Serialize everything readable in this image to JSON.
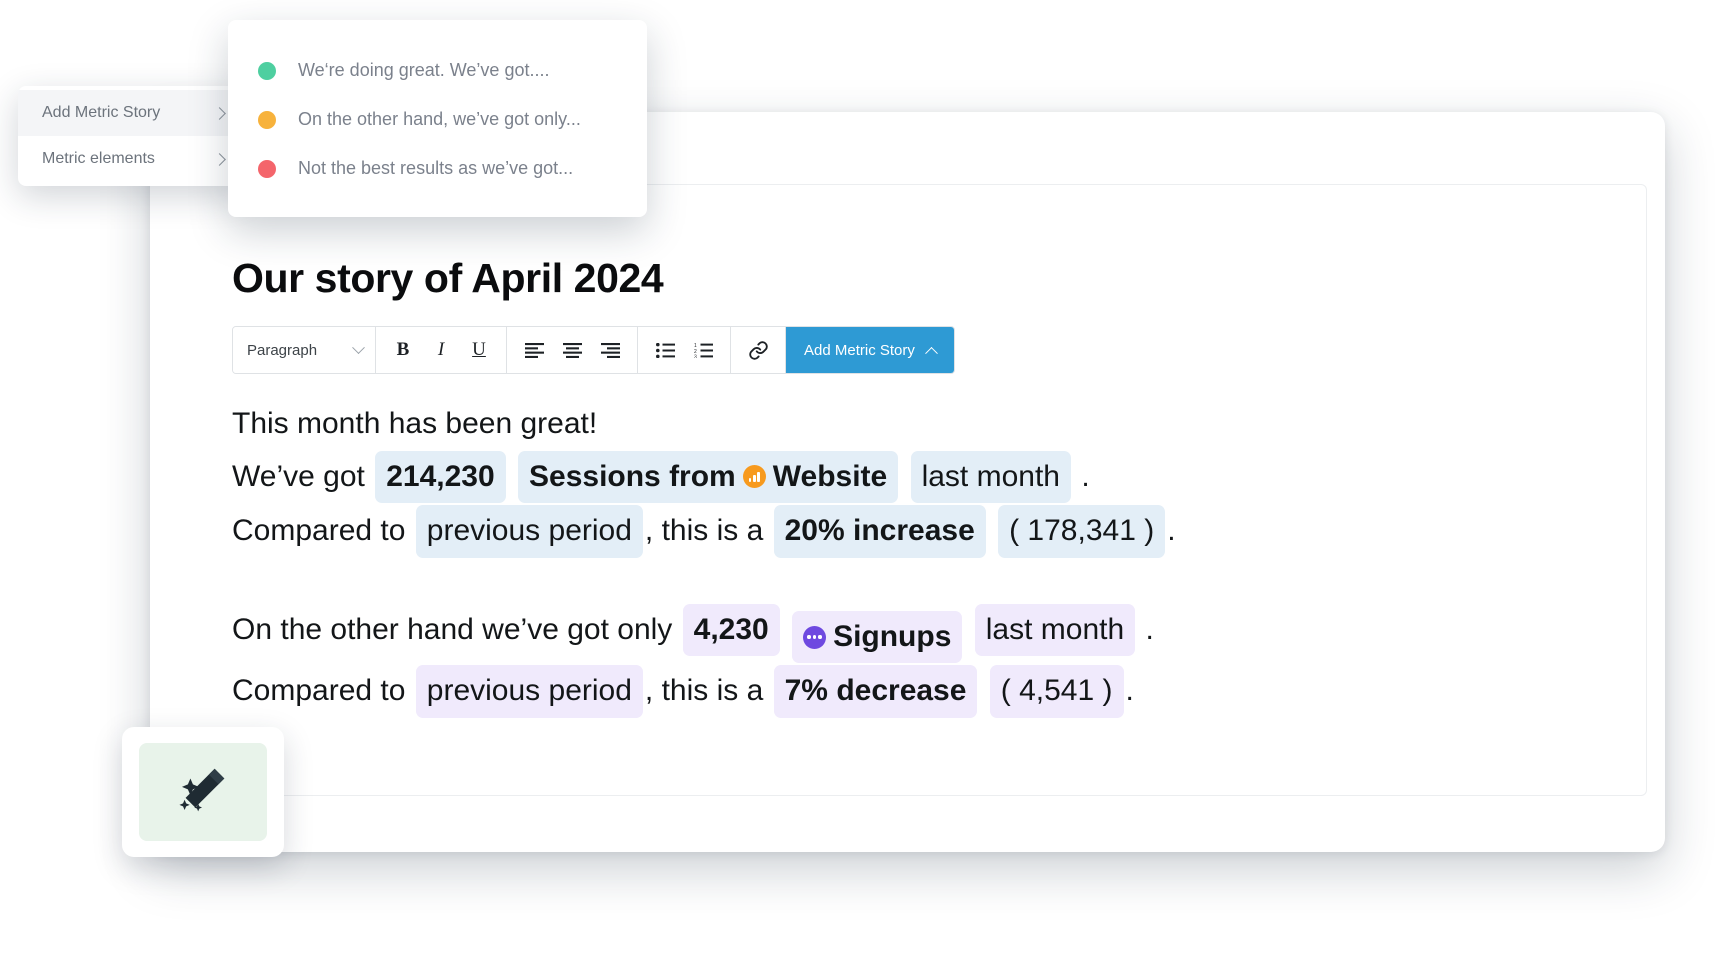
{
  "window": {
    "title": ""
  },
  "sidebar": {
    "items": [
      {
        "label": "Add Metric Story",
        "icon": "chevron-right-icon",
        "active": true
      },
      {
        "label": "Metric elements",
        "icon": "chevron-right-icon",
        "active": false
      }
    ]
  },
  "story_dropdown": {
    "items": [
      {
        "label": "We‘re doing great. We’ve got....",
        "color": "#4ecfa0"
      },
      {
        "label": "On the other hand, we’ve got only...",
        "color": "#f7b23c"
      },
      {
        "label": "Not the best results as we’ve got...",
        "color": "#f4656b"
      }
    ]
  },
  "document": {
    "title": "Our story of April 2024"
  },
  "toolbar": {
    "paragraph_label": "Paragraph",
    "paragraph_chevron": "chevron-down-icon",
    "bold_label": "B",
    "italic_label": "I",
    "underline_label": "U",
    "align_left_label": "align-left",
    "align_center_label": "align-center",
    "align_right_label": "align-right",
    "bullet_list_label": "bullet-list",
    "numbered_list_label": "numbered-list",
    "link_label": "link",
    "add_metric_story_label": "Add Metric Story",
    "add_metric_story_chevron": "chevron-up-icon",
    "accent_color": "#2e9ad4"
  },
  "body": {
    "line1": "This month has been great!",
    "line2": {
      "prefix": "We’ve got",
      "value_chip": "214,230",
      "metric_chip_text": "Sessions from",
      "source_name": "Website",
      "source_icon": "bar-chart-icon",
      "source_icon_color": "#f79a1e",
      "period_chip": "last month",
      "suffix": "."
    },
    "line3": {
      "prefix": "Compared to",
      "period_chip": "previous period",
      "middle": ", this is a",
      "change_chip": "20% increase",
      "compare_chip": "( 178,341 )",
      "suffix": "."
    },
    "line4": {
      "prefix": "On the other hand we’ve got only",
      "value_chip": "4,230",
      "source_name": "Signups",
      "source_icon": "dots-circle-icon",
      "source_icon_color": "#6e49e0",
      "period_chip": "last month",
      "suffix": "."
    },
    "line5": {
      "prefix": "Compared to",
      "period_chip": "previous period",
      "middle": ", this is a",
      "change_chip": "7% decrease",
      "compare_chip": "( 4,541 )",
      "suffix": "."
    }
  },
  "magic_card": {
    "icon": "magic-wand-icon",
    "background": "#e8f3ea"
  },
  "colors": {
    "chip_blue": "#e3eef7",
    "chip_purple": "#f0eafc",
    "accent_blue": "#2e9ad4"
  }
}
